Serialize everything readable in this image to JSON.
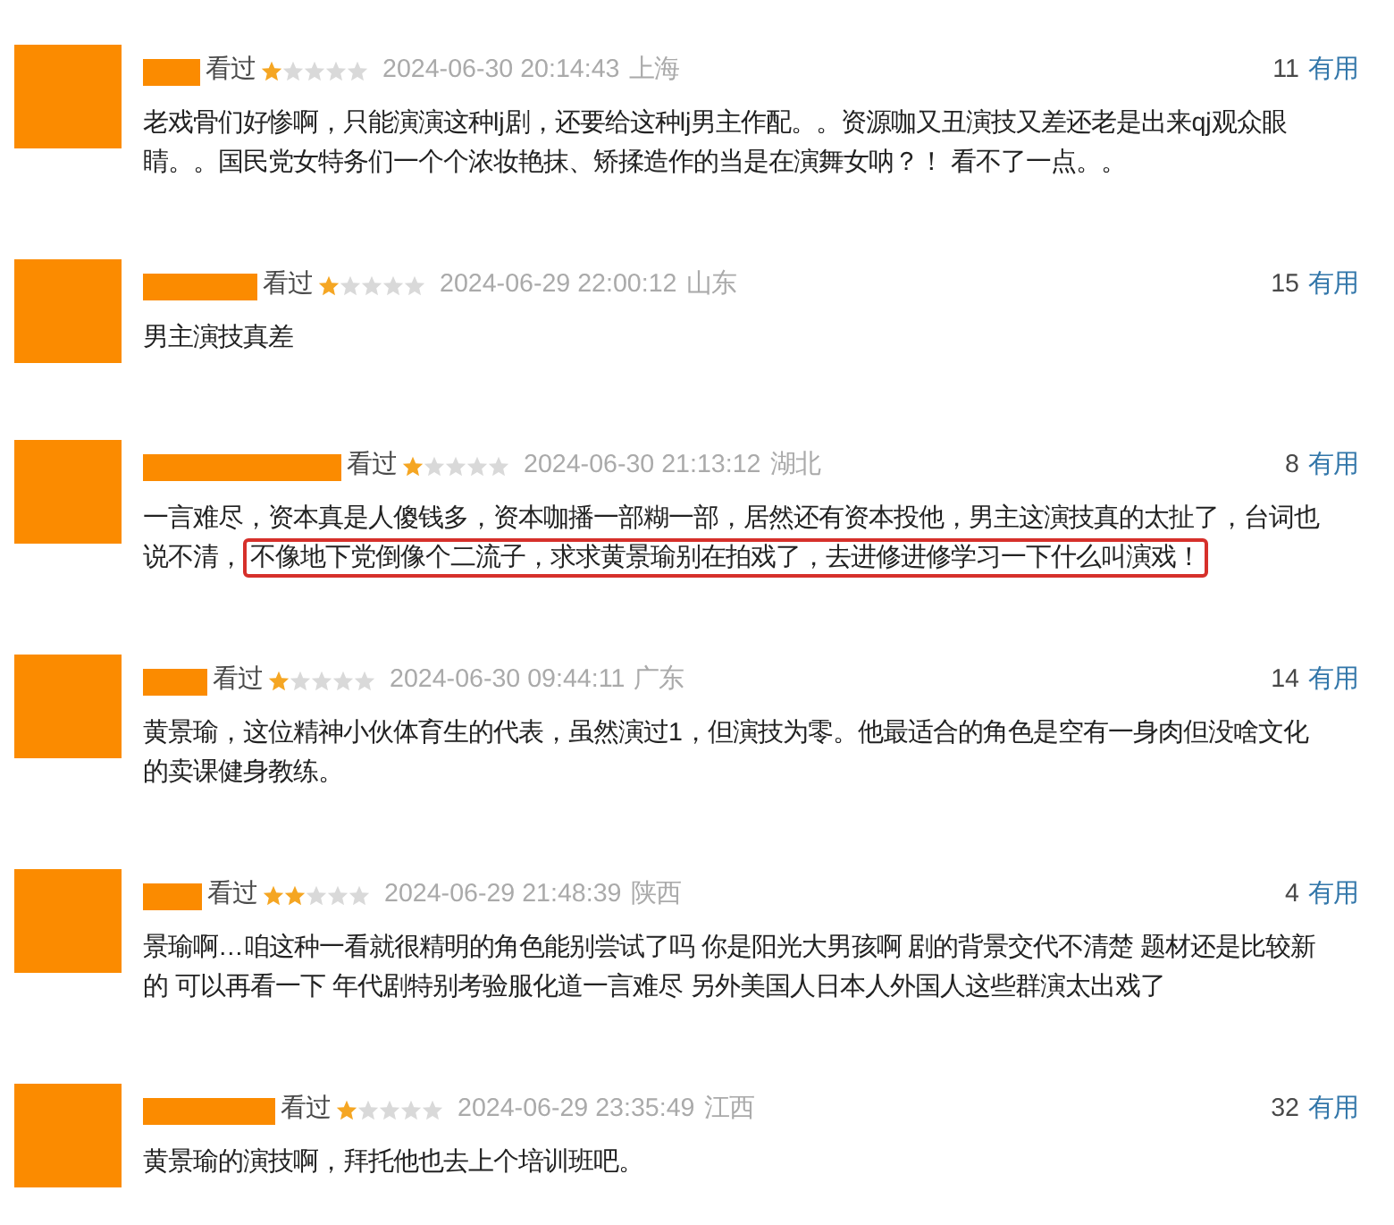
{
  "reviews": [
    {
      "status": "看过",
      "stars": 1,
      "time": "2024-06-30 20:14:43",
      "location": "上海",
      "votes": "11",
      "vote_label": "有用",
      "content": [
        {
          "text": "老戏骨们好惨啊，只能演演这种lj剧，还要给这种lj男主作配。。资源咖又丑演技又差还老是出来qj观众眼睛。。国民党女特务们一个个浓妆艳抹、矫揉造作的当是在演舞女呐？！ 看不了一点。。",
          "highlighted": false
        }
      ]
    },
    {
      "status": "看过",
      "stars": 1,
      "time": "2024-06-29 22:00:12",
      "location": "山东",
      "votes": "15",
      "vote_label": "有用",
      "content": [
        {
          "text": "男主演技真差",
          "highlighted": false
        }
      ]
    },
    {
      "status": "看过",
      "stars": 1,
      "time": "2024-06-30 21:13:12",
      "location": "湖北",
      "votes": "8",
      "vote_label": "有用",
      "content": [
        {
          "text": "一言难尽，资本真是人傻钱多，资本咖播一部糊一部，居然还有资本投他，男主这演技真的太扯了，台词也说不清，",
          "highlighted": false
        },
        {
          "text": "不像地下党倒像个二流子，求求黄景瑜别在拍戏了，去进修进修学习一下什么叫演戏！",
          "highlighted": true
        }
      ]
    },
    {
      "status": "看过",
      "stars": 1,
      "time": "2024-06-30 09:44:11",
      "location": "广东",
      "votes": "14",
      "vote_label": "有用",
      "content": [
        {
          "text": "黄景瑜，这位精神小伙体育生的代表，虽然演过1，但演技为零。他最适合的角色是空有一身肉但没啥文化的卖课健身教练。",
          "highlighted": false
        }
      ]
    },
    {
      "status": "看过",
      "stars": 2,
      "time": "2024-06-29 21:48:39",
      "location": "陕西",
      "votes": "4",
      "vote_label": "有用",
      "content": [
        {
          "text": "景瑜啊…咱这种一看就很精明的角色能别尝试了吗 你是阳光大男孩啊 剧的背景交代不清楚 题材还是比较新的 可以再看一下 年代剧特别考验服化道一言难尽 另外美国人日本人外国人这些群演太出戏了",
          "highlighted": false
        }
      ]
    },
    {
      "status": "看过",
      "stars": 1,
      "time": "2024-06-29 23:35:49",
      "location": "江西",
      "votes": "32",
      "vote_label": "有用",
      "content": [
        {
          "text": "黄景瑜的演技啊，拜托他也去上个培训班吧。",
          "highlighted": false
        }
      ]
    }
  ]
}
